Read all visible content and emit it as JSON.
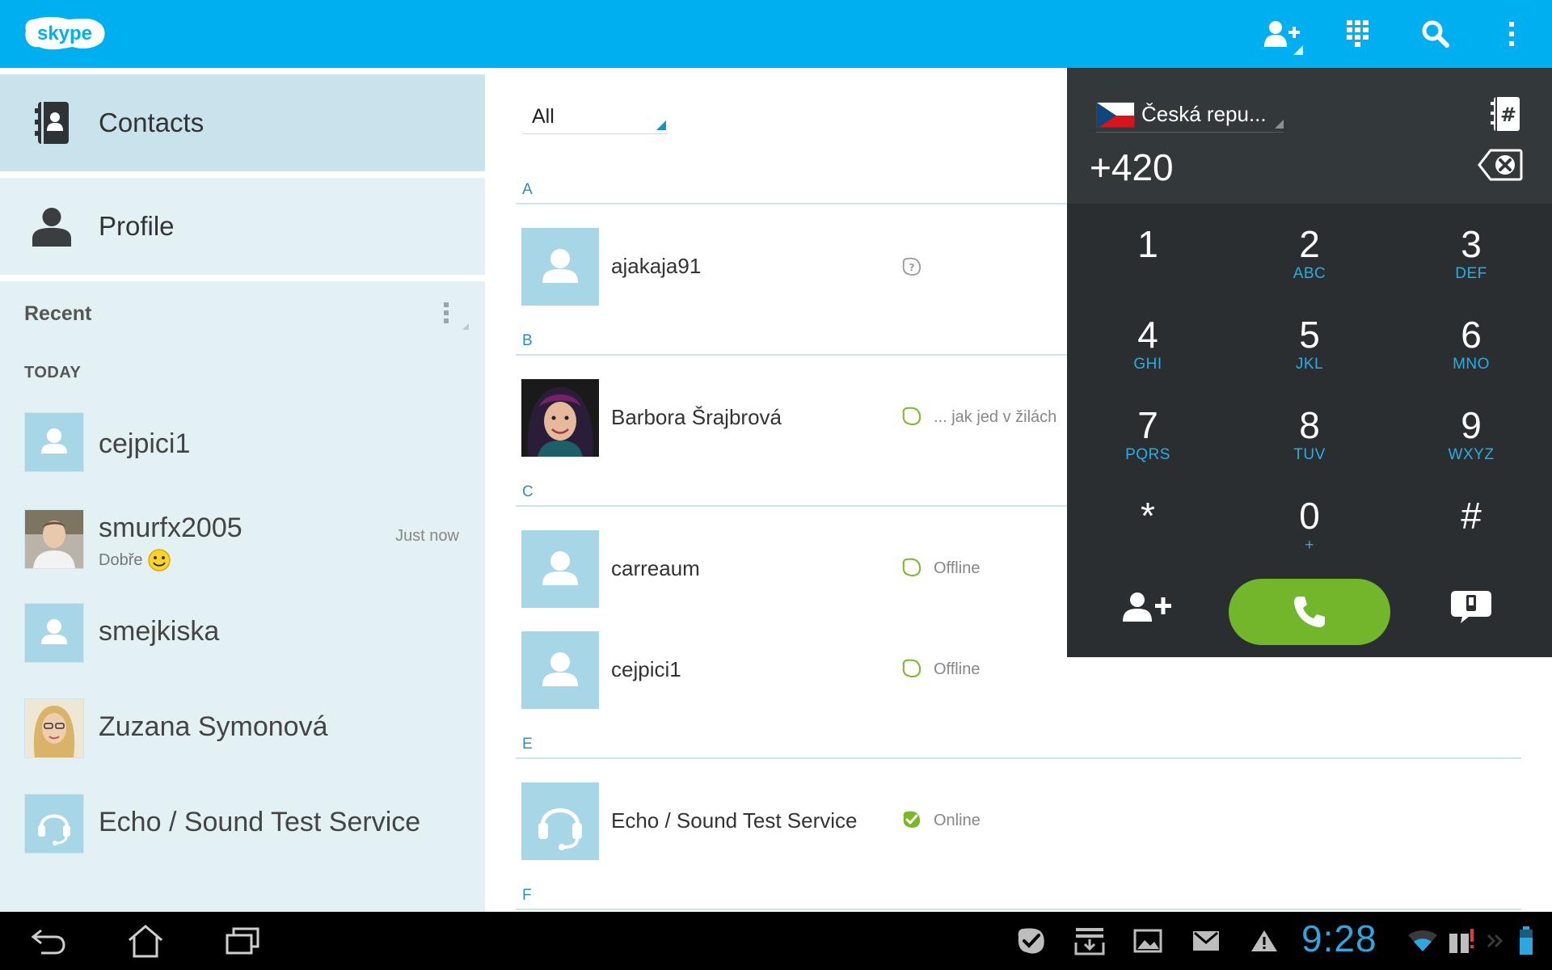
{
  "app": {
    "logo_text": "skype",
    "accent_color": "#00aff0"
  },
  "toolbar": {
    "icons": [
      "add-contact-icon",
      "dialpad-icon",
      "search-icon",
      "overflow-menu-icon"
    ]
  },
  "sidebar": {
    "nav": [
      {
        "label": "Contacts",
        "icon": "contacts-book-icon",
        "active": true
      },
      {
        "label": "Profile",
        "icon": "person-icon",
        "active": false
      }
    ],
    "recent_title": "Recent",
    "today_label": "TODAY",
    "recent_items": [
      {
        "name": "cejpici1",
        "time": "",
        "subtitle": ""
      },
      {
        "name": "smurfx2005",
        "time": "Just now",
        "subtitle": "Dobře"
      },
      {
        "name": "smejkiska",
        "time": "",
        "subtitle": ""
      },
      {
        "name": "Zuzana Symonová",
        "time": "",
        "subtitle": ""
      },
      {
        "name": "Echo / Sound Test Service",
        "time": "",
        "subtitle": ""
      }
    ]
  },
  "contacts": {
    "filter": "All",
    "sections": [
      {
        "letter": "A",
        "items": [
          {
            "name": "ajakaja91",
            "status": "",
            "status_type": "pending"
          }
        ]
      },
      {
        "letter": "B",
        "items": [
          {
            "name": "Barbora Šrajbrová",
            "status": "... jak jed v žilách",
            "status_type": "offline"
          }
        ]
      },
      {
        "letter": "C",
        "items": [
          {
            "name": "carreaum",
            "status": "Offline",
            "status_type": "offline"
          },
          {
            "name": "cejpici1",
            "status": "Offline",
            "status_type": "offline"
          }
        ]
      },
      {
        "letter": "E",
        "items": [
          {
            "name": "Echo / Sound Test Service",
            "status": "Online",
            "status_type": "online"
          }
        ]
      },
      {
        "letter": "F",
        "items": []
      }
    ]
  },
  "dialpad": {
    "country": "Česká repu...",
    "number": "+420",
    "keys": [
      {
        "digit": "1",
        "letters": ""
      },
      {
        "digit": "2",
        "letters": "ABC"
      },
      {
        "digit": "3",
        "letters": "DEF"
      },
      {
        "digit": "4",
        "letters": "GHI"
      },
      {
        "digit": "5",
        "letters": "JKL"
      },
      {
        "digit": "6",
        "letters": "MNO"
      },
      {
        "digit": "7",
        "letters": "PQRS"
      },
      {
        "digit": "8",
        "letters": "TUV"
      },
      {
        "digit": "9",
        "letters": "WXYZ"
      },
      {
        "digit": "*",
        "letters": ""
      },
      {
        "digit": "0",
        "letters": "+"
      },
      {
        "digit": "#",
        "letters": ""
      }
    ],
    "call_color": "#72b62b"
  },
  "system_bar": {
    "clock": "9:28"
  }
}
